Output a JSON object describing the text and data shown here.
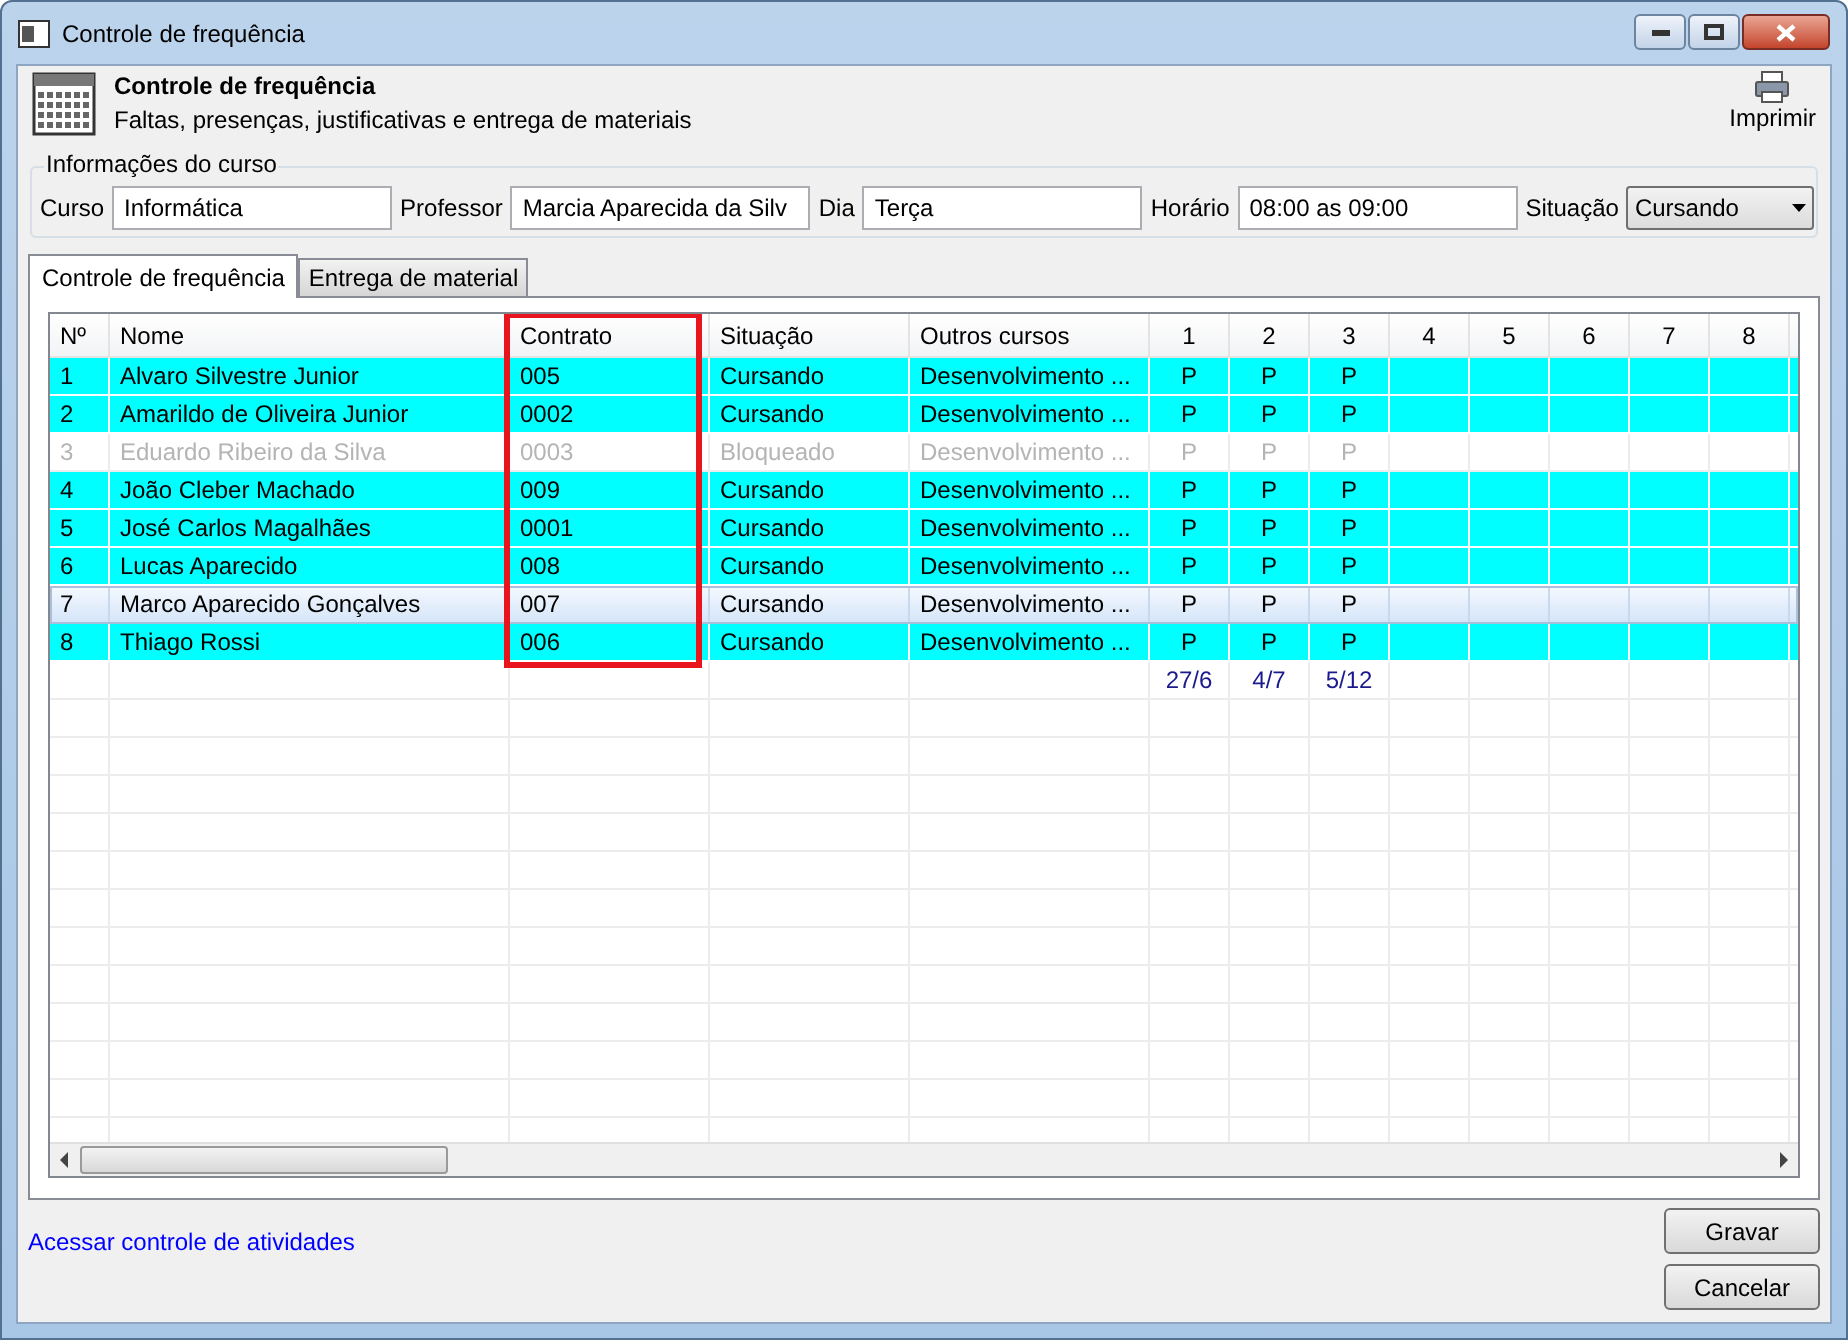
{
  "window": {
    "title": "Controle de frequência"
  },
  "header": {
    "title": "Controle de frequência",
    "subtitle": "Faltas, presenças, justificativas e entrega de materiais",
    "print_button": "Imprimir"
  },
  "course_info": {
    "legend": "Informações do curso",
    "fields": [
      {
        "label": "Curso",
        "value": "Informática",
        "kind": "text"
      },
      {
        "label": "Professor",
        "value": "Marcia Aparecida da Silv",
        "kind": "text"
      },
      {
        "label": "Dia",
        "value": "Terça",
        "kind": "text"
      },
      {
        "label": "Horário",
        "value": "08:00 as 09:00",
        "kind": "text"
      },
      {
        "label": "Situação",
        "value": "Cursando",
        "kind": "select"
      }
    ]
  },
  "tabs": [
    {
      "label": "Controle de frequência",
      "selected": true
    },
    {
      "label": "Entrega de material",
      "selected": false
    }
  ],
  "table": {
    "columns": [
      "Nº",
      "Nome",
      "Contrato",
      "Situação",
      "Outros cursos",
      "1",
      "2",
      "3",
      "4",
      "5",
      "6",
      "7",
      "8"
    ],
    "rows": [
      {
        "cells": [
          "1",
          "Alvaro Silvestre Junior",
          "005",
          "Cursando",
          "Desenvolvimento ...",
          "P",
          "P",
          "P",
          "",
          "",
          "",
          "",
          ""
        ],
        "highlighted": true,
        "disabled": false,
        "selected": false
      },
      {
        "cells": [
          "2",
          "Amarildo de Oliveira Junior",
          "0002",
          "Cursando",
          "Desenvolvimento ...",
          "P",
          "P",
          "P",
          "",
          "",
          "",
          "",
          ""
        ],
        "highlighted": true,
        "disabled": false,
        "selected": false
      },
      {
        "cells": [
          "3",
          "Eduardo Ribeiro da Silva",
          "0003",
          "Bloqueado",
          "Desenvolvimento ...",
          "P",
          "P",
          "P",
          "",
          "",
          "",
          "",
          ""
        ],
        "highlighted": false,
        "disabled": true,
        "selected": false
      },
      {
        "cells": [
          "4",
          "João Cleber Machado",
          "009",
          "Cursando",
          "Desenvolvimento ...",
          "P",
          "P",
          "P",
          "",
          "",
          "",
          "",
          ""
        ],
        "highlighted": true,
        "disabled": false,
        "selected": false
      },
      {
        "cells": [
          "5",
          "José Carlos Magalhães",
          "0001",
          "Cursando",
          "Desenvolvimento ...",
          "P",
          "P",
          "P",
          "",
          "",
          "",
          "",
          ""
        ],
        "highlighted": true,
        "disabled": false,
        "selected": false
      },
      {
        "cells": [
          "6",
          "Lucas Aparecido",
          "008",
          "Cursando",
          "Desenvolvimento ...",
          "P",
          "P",
          "P",
          "",
          "",
          "",
          "",
          ""
        ],
        "highlighted": true,
        "disabled": false,
        "selected": false
      },
      {
        "cells": [
          "7",
          "Marco Aparecido Gonçalves",
          "007",
          "Cursando",
          "Desenvolvimento ...",
          "P",
          "P",
          "P",
          "",
          "",
          "",
          "",
          ""
        ],
        "highlighted": false,
        "disabled": false,
        "selected": true
      },
      {
        "cells": [
          "8",
          "Thiago Rossi",
          "006",
          "Cursando",
          "Desenvolvimento ...",
          "P",
          "P",
          "P",
          "",
          "",
          "",
          "",
          ""
        ],
        "highlighted": true,
        "disabled": false,
        "selected": false
      }
    ],
    "dates": [
      "27/6",
      "4/7",
      "5/12"
    ]
  },
  "footer": {
    "link": "Acessar controle de atividades",
    "buttons": [
      "Gravar",
      "Cancelar"
    ]
  }
}
